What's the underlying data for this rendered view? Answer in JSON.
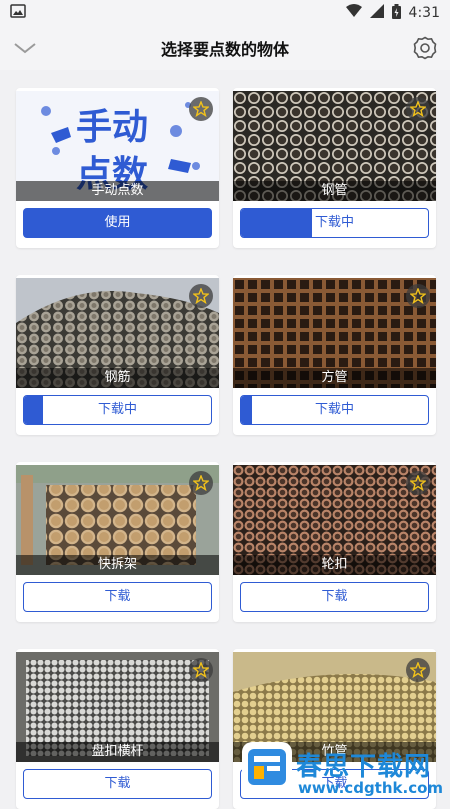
{
  "status_bar": {
    "time": "4:31"
  },
  "header": {
    "title": "选择要点数的物体"
  },
  "items": [
    {
      "name": "手动点数",
      "button": "使用",
      "state": "use",
      "progress": null,
      "thumb": "manual",
      "manual_text": [
        "手动",
        "点数"
      ]
    },
    {
      "name": "钢管",
      "button": "下载中",
      "state": "downloading",
      "progress": 0.38,
      "thumb": "pipe"
    },
    {
      "name": "钢筋",
      "button": "下载中",
      "state": "downloading",
      "progress": 0.1,
      "thumb": "rebar"
    },
    {
      "name": "方管",
      "button": "下载中",
      "state": "downloading",
      "progress": 0.06,
      "thumb": "square"
    },
    {
      "name": "快拆架",
      "button": "下载",
      "state": "download",
      "progress": null,
      "thumb": "quick"
    },
    {
      "name": "轮扣",
      "button": "下载",
      "state": "download",
      "progress": null,
      "thumb": "wheel"
    },
    {
      "name": "盘扣横杆",
      "button": "下载",
      "state": "download",
      "progress": null,
      "thumb": "disc"
    },
    {
      "name": "竹管",
      "button": "下载",
      "state": "download",
      "progress": null,
      "thumb": "bamboo"
    }
  ],
  "watermark": {
    "brand": "春思下载网",
    "url": "www.cdgthk.com"
  },
  "colors": {
    "accent": "#2f5bd3",
    "star": "#f2c21b"
  }
}
